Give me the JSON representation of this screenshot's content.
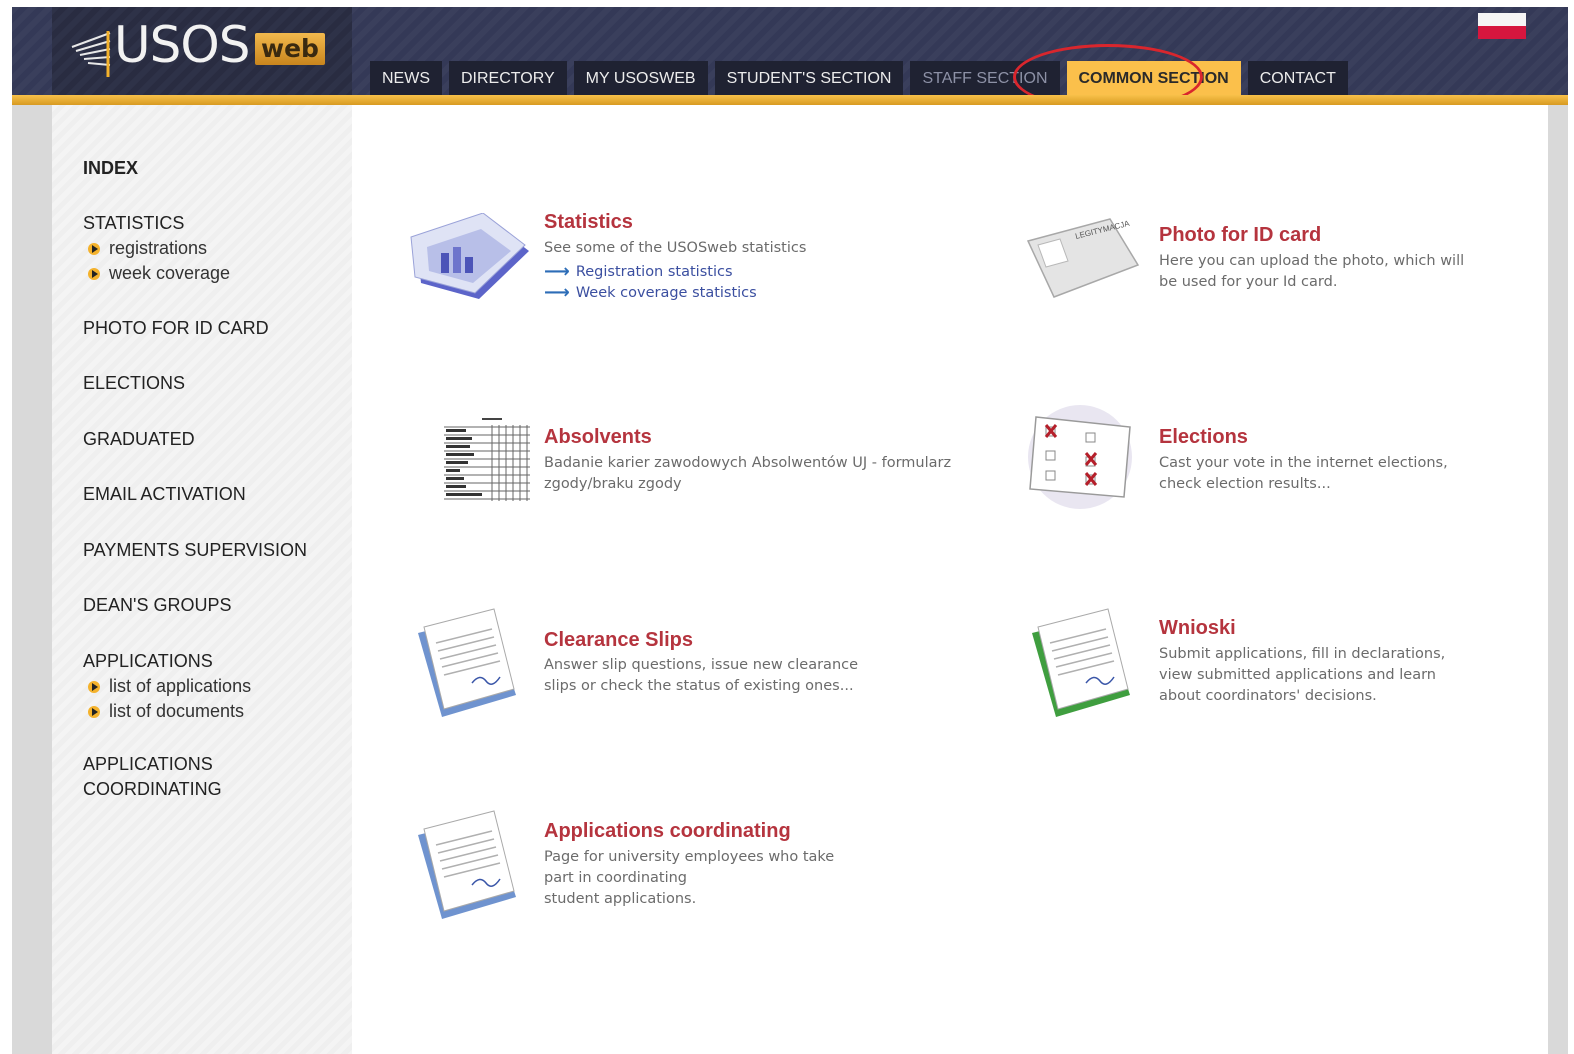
{
  "header": {
    "logo_main": "USOS",
    "logo_suffix": "web",
    "flag": "flag-pl-icon",
    "nav": [
      "NEWS",
      "DIRECTORY",
      "MY USOSWEB",
      "STUDENT'S SECTION",
      "STAFF SECTION",
      "COMMON SECTION",
      "CONTACT"
    ],
    "active_tab": "COMMON SECTION"
  },
  "sidebar": {
    "index": "INDEX",
    "statistics": "STATISTICS",
    "statistics_items": [
      "registrations",
      "week coverage"
    ],
    "photo": "PHOTO FOR ID CARD",
    "elections": "ELECTIONS",
    "graduated": "GRADUATED",
    "email": "EMAIL ACTIVATION",
    "payments": "PAYMENTS SUPERVISION",
    "deans": "DEAN'S GROUPS",
    "applications": "APPLICATIONS",
    "applications_items": [
      "list of applications",
      "list of documents"
    ],
    "coordinating_1": "APPLICATIONS",
    "coordinating_2": "COORDINATING"
  },
  "cards": {
    "statistics": {
      "title": "Statistics",
      "desc": "See some of the USOSweb statistics",
      "links": [
        "Registration statistics",
        "Week coverage statistics"
      ]
    },
    "photo": {
      "title": "Photo for ID card",
      "desc1": "Here you can upload the photo, which will",
      "desc2": "be used for your Id card.",
      "card_text": "LEGITYMACJA"
    },
    "absolvents": {
      "title": "Absolvents",
      "desc1": "Badanie karier zawodowych Absolwentów UJ - formularz",
      "desc2": "zgody/braku zgody"
    },
    "elections": {
      "title": "Elections",
      "desc1": "Cast your vote in the internet elections,",
      "desc2": "check election results..."
    },
    "clearance": {
      "title": "Clearance Slips",
      "desc1": "Answer slip questions, issue new clearance",
      "desc2": "slips or check the status of existing ones..."
    },
    "wnioski": {
      "title": "Wnioski",
      "desc1": "Submit applications, fill in declarations,",
      "desc2": "view submitted applications and learn",
      "desc3": "about coordinators' decisions."
    },
    "coordinating": {
      "title": "Applications coordinating",
      "desc1": "Page for university employees who take",
      "desc2": "part in coordinating",
      "desc3": "student applications."
    }
  },
  "colors": {
    "header_bg": "#3a3f5c",
    "accent_gold": "#fbc04b",
    "title_red": "#b5343e",
    "link_blue": "#3b4fa0",
    "highlight_ring": "#d9262d"
  }
}
